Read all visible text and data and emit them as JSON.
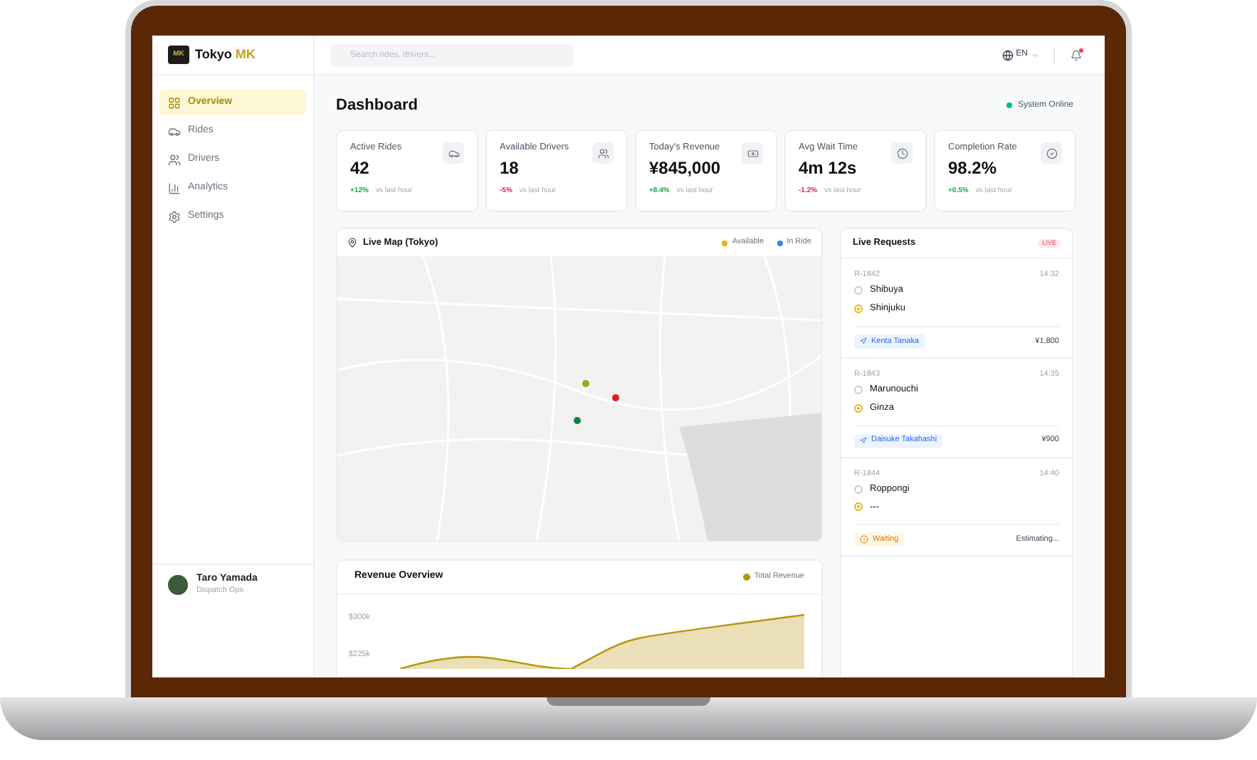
{
  "brand": {
    "logo": "MK",
    "name": "Tokyo",
    "accent": "MK"
  },
  "search": {
    "placeholder": "Search rides, drivers..."
  },
  "language": {
    "label": "EN"
  },
  "notifications": {
    "unread": true
  },
  "sidebar": {
    "items": [
      {
        "label": "Overview",
        "selected": true
      },
      {
        "label": "Rides",
        "selected": false
      },
      {
        "label": "Drivers",
        "selected": false
      },
      {
        "label": "Analytics",
        "selected": false
      },
      {
        "label": "Settings",
        "selected": false
      }
    ]
  },
  "user": {
    "name": "Taro Yamada",
    "role": "Dispatch Ops"
  },
  "page": {
    "title": "Dashboard",
    "status": {
      "label": "System Online",
      "color": "#10b981"
    }
  },
  "stats": [
    {
      "label": "Active Rides",
      "value": "42",
      "change": "+12%",
      "positive": true,
      "note": "vs last hour"
    },
    {
      "label": "Available Drivers",
      "value": "18",
      "change": "-5%",
      "positive": false,
      "note": "vs last hour"
    },
    {
      "label": "Today's Revenue",
      "value": "¥845,000",
      "change": "+8.4%",
      "positive": true,
      "note": "vs last hour"
    },
    {
      "label": "Avg Wait Time",
      "value": "4m 12s",
      "change": "-1.2%",
      "positive": false,
      "note": "vs last hour"
    },
    {
      "label": "Completion Rate",
      "value": "98.2%",
      "change": "+0.5%",
      "positive": true,
      "note": "vs last hour"
    }
  ],
  "map": {
    "title": "Live Map (Tokyo)",
    "legend": [
      {
        "label": "Available",
        "color": "#eab308"
      },
      {
        "label": "In Ride",
        "color": "#3b82f6"
      }
    ],
    "markers": [
      {
        "color": "#9ca31a"
      },
      {
        "color": "#dc1f1f"
      },
      {
        "color": "#15803d"
      }
    ]
  },
  "requests": {
    "title": "Live Requests",
    "badge": "LIVE",
    "items": [
      {
        "id": "R-1842",
        "time": "14:32",
        "pickup": "Shibuya",
        "dropoff": "Shinjuku",
        "status": {
          "kind": "driver",
          "label": "Kenta Tanaka"
        },
        "fare": "¥1,800"
      },
      {
        "id": "R-1843",
        "time": "14:35",
        "pickup": "Marunouchi",
        "dropoff": "Ginza",
        "status": {
          "kind": "driver",
          "label": "Daisuke Takahashi"
        },
        "fare": "¥900"
      },
      {
        "id": "R-1844",
        "time": "14:40",
        "pickup": "Roppongi",
        "dropoff": "---",
        "status": {
          "kind": "waiting",
          "label": "Waiting"
        },
        "fare": "Estimating..."
      }
    ]
  },
  "revenue": {
    "title": "Revenue Overview",
    "legend": {
      "label": "Total Revenue",
      "color": "#b8960c"
    },
    "y_axis_labels": [
      "$300k",
      "$225k"
    ]
  }
}
